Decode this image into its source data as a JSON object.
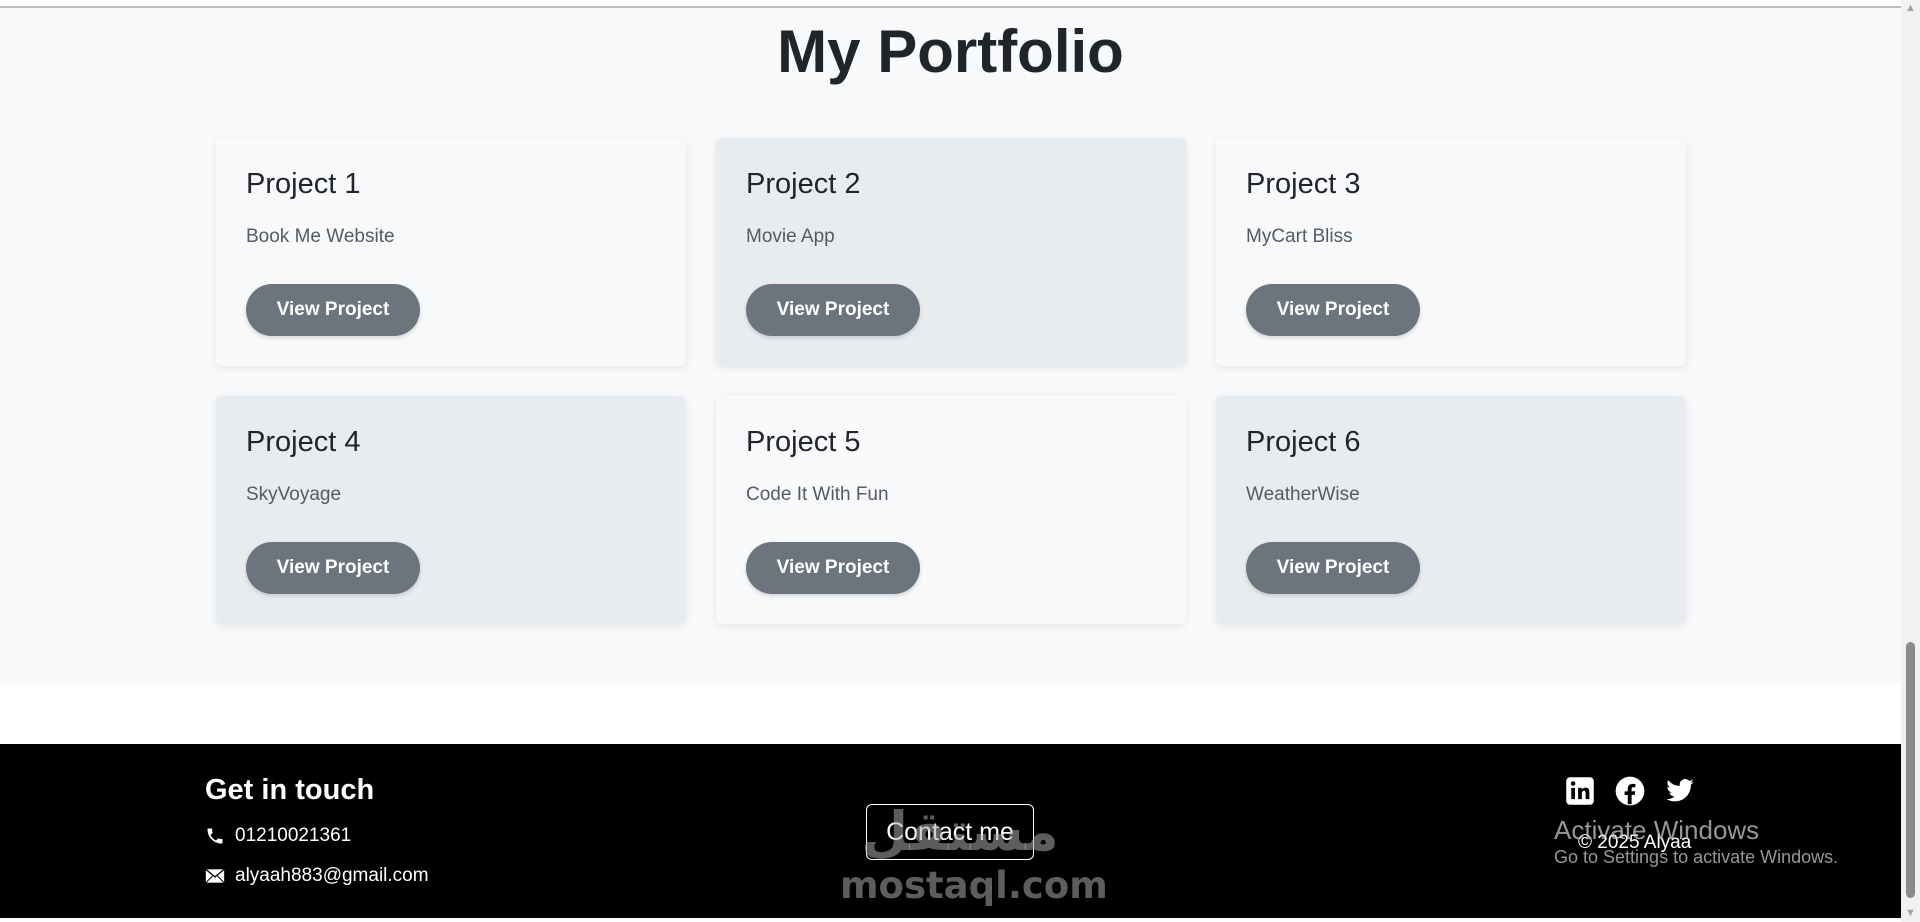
{
  "portfolio": {
    "title": "My Portfolio",
    "projects": [
      {
        "title": "Project 1",
        "description": "Book Me Website",
        "button": "View Project"
      },
      {
        "title": "Project 2",
        "description": "Movie App",
        "button": "View Project"
      },
      {
        "title": "Project 3",
        "description": "MyCart Bliss",
        "button": "View Project"
      },
      {
        "title": "Project 4",
        "description": "SkyVoyage",
        "button": "View Project"
      },
      {
        "title": "Project 5",
        "description": "Code It With Fun",
        "button": "View Project"
      },
      {
        "title": "Project 6",
        "description": "WeatherWise",
        "button": "View Project"
      }
    ]
  },
  "footer": {
    "heading": "Get in touch",
    "phone": "01210021361",
    "email": "alyaah883@gmail.com",
    "contact_button": "Contact me",
    "copyright": "© 2025 Alyaa",
    "social_icons": [
      "linkedin-icon",
      "facebook-icon",
      "twitter-icon"
    ]
  },
  "watermark": {
    "arabic": "مستقل",
    "latin": "mostaql.com"
  },
  "windows_activation": {
    "title": "Activate Windows",
    "subtitle": "Go to Settings to activate Windows."
  },
  "colors": {
    "section_bg": "#f8f9fa",
    "card_alt_bg": "#e9ecef",
    "button_bg": "#6c757d",
    "footer_bg": "#000000"
  }
}
